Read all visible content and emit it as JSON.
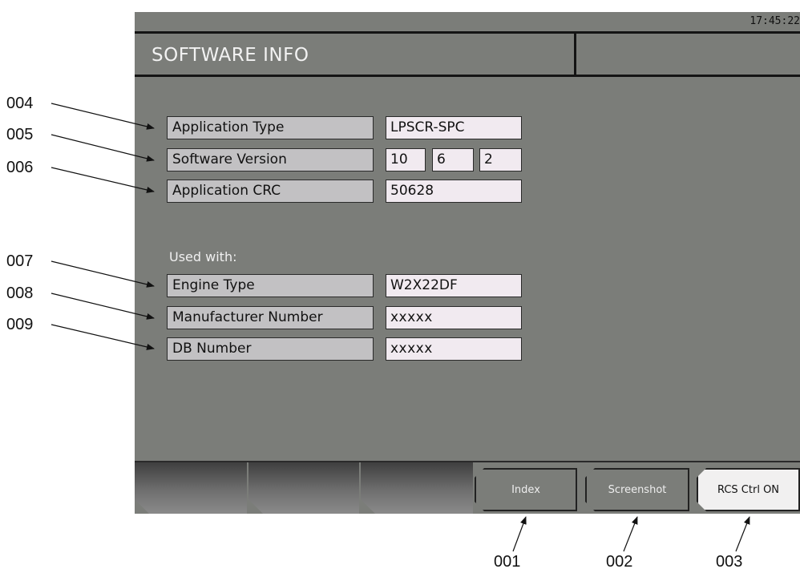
{
  "status_bar": {
    "clock": "17:45:22"
  },
  "header": {
    "title": "SOFTWARE INFO"
  },
  "fields": {
    "application_type": {
      "label": "Application Type",
      "value": "LPSCR-SPC"
    },
    "software_version": {
      "label": "Software Version",
      "major": "10",
      "minor": "6",
      "patch": "2"
    },
    "application_crc": {
      "label": "Application CRC",
      "value": "50628"
    },
    "used_with_heading": "Used with:",
    "engine_type": {
      "label": "Engine Type",
      "value": "W2X22DF"
    },
    "manufacturer_number": {
      "label": "Manufacturer Number",
      "value": "xxxxx"
    },
    "db_number": {
      "label": "DB Number",
      "value": "xxxxx"
    }
  },
  "softkeys": {
    "index": "Index",
    "screenshot": "Screenshot",
    "rcs_ctrl": "RCS Ctrl ON"
  },
  "callouts": {
    "c001": "001",
    "c002": "002",
    "c003": "003",
    "c004": "004",
    "c005": "005",
    "c006": "006",
    "c007": "007",
    "c008": "008",
    "c009": "009"
  }
}
